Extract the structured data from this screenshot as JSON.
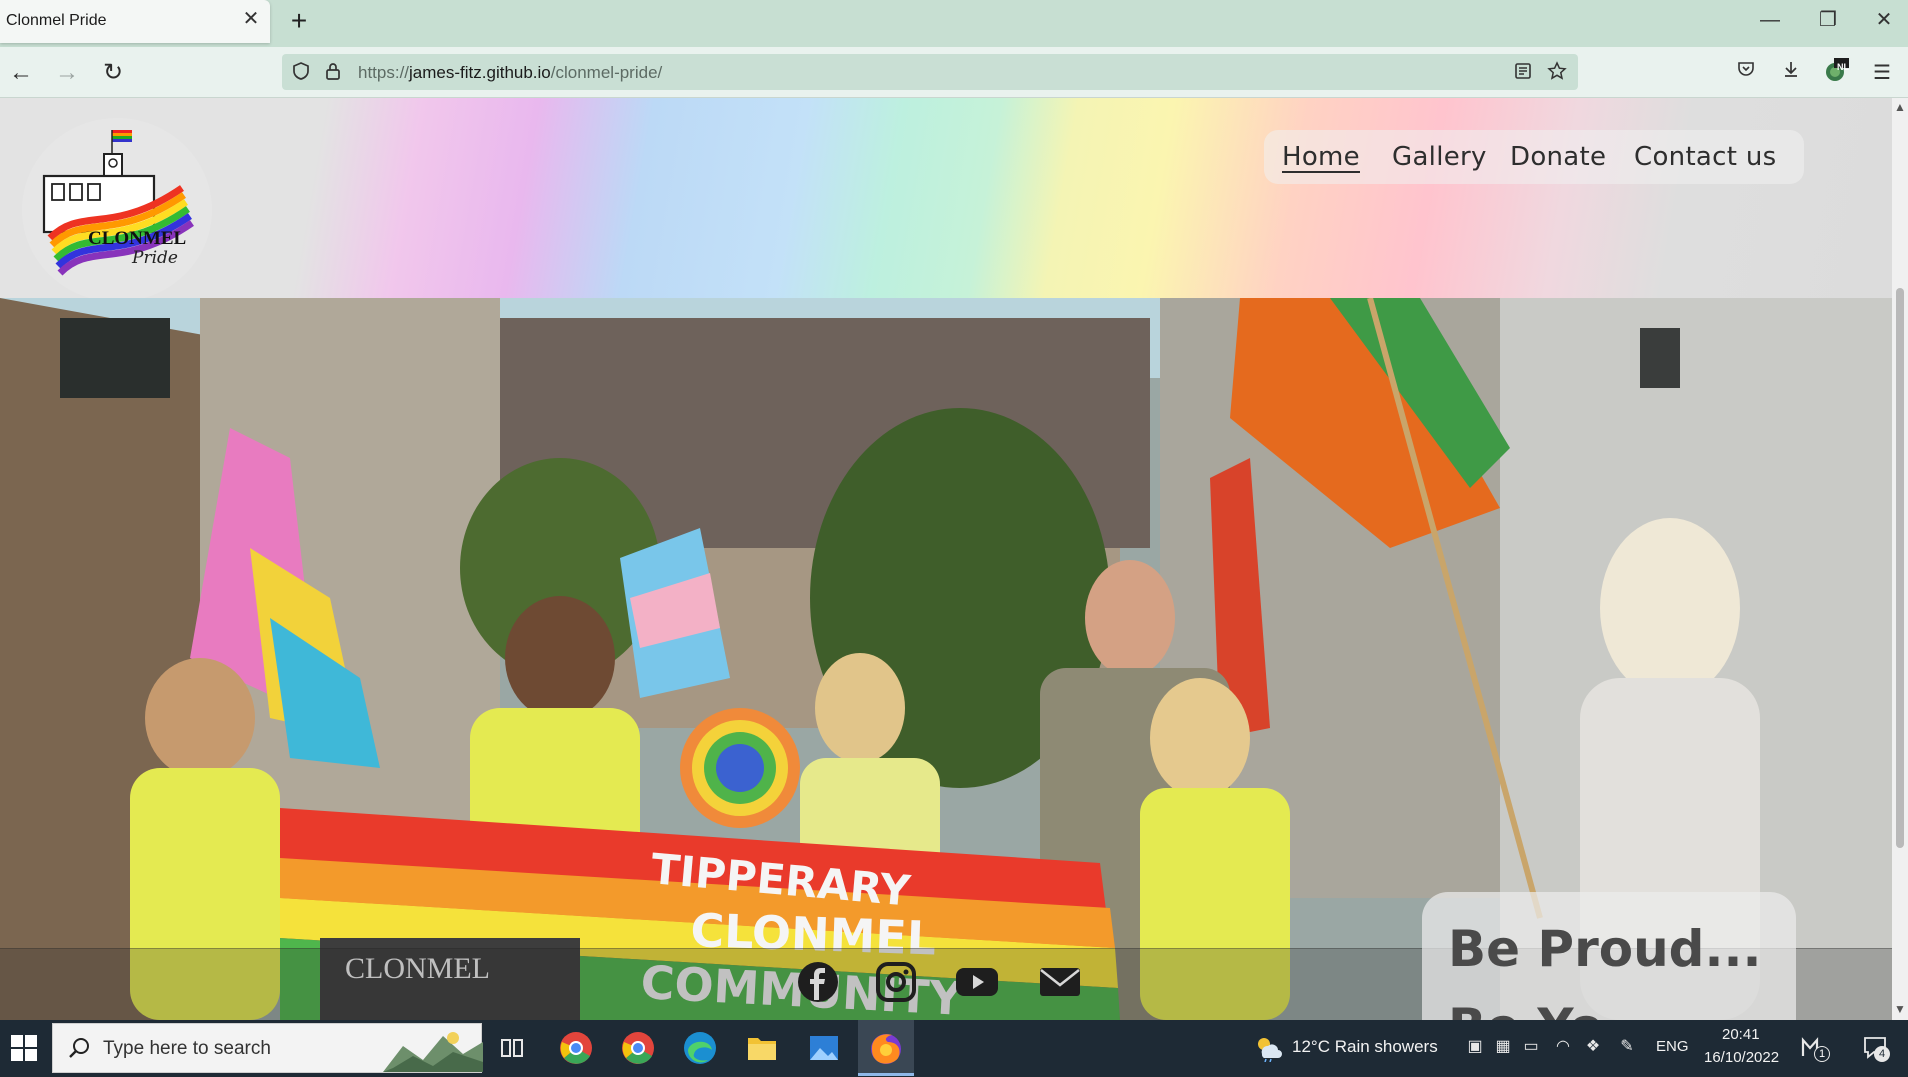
{
  "browser": {
    "tab_title": "Clonmel Pride",
    "tab_close": "✕",
    "new_tab": "+",
    "window_controls": {
      "minimize": "—",
      "restore": "❐",
      "close": "✕"
    },
    "url": {
      "scheme": "https://",
      "host": "james-fitz.github.io",
      "path": "/clonmel-pride/"
    },
    "extension_badge": "NL"
  },
  "site": {
    "logo": {
      "name": "CLONMEL",
      "script": "Pride"
    },
    "nav": [
      {
        "label": "Home",
        "active": true
      },
      {
        "label": "Gallery",
        "active": false
      },
      {
        "label": "Donate",
        "active": false
      },
      {
        "label": "Contact us",
        "active": false
      }
    ],
    "hero": {
      "banner_text_1": "TIPPERARY",
      "banner_text_2": "CLONMEL",
      "banner_text_3": "COMMUNITY",
      "sign_text": "CLONMEL"
    },
    "tagline_line1": "Be Proud...",
    "tagline_line2": "Be Yo",
    "social": [
      "facebook-icon",
      "instagram-icon",
      "youtube-icon",
      "email-icon"
    ]
  },
  "taskbar": {
    "search_placeholder": "Type here to search",
    "weather": "12°C  Rain showers",
    "language": "ENG",
    "time": "20:41",
    "date": "16/10/2022",
    "notification_count": "4",
    "mail_count": "1"
  },
  "colors": {
    "tabbar_bg": "#c7dfd2",
    "taskbar_bg": "#1e2a35",
    "nav_text": "#2e2e2e"
  }
}
